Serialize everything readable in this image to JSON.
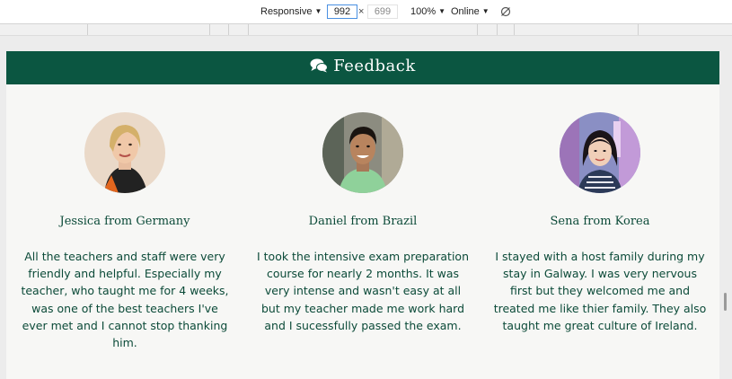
{
  "toolbar": {
    "device": "Responsive",
    "width": "992",
    "height": "699",
    "zoom": "100%",
    "network": "Online",
    "rotate_icon": "rotate-icon"
  },
  "section": {
    "title": "Feedback",
    "icon": "comments-icon",
    "header_color": "#0b5641"
  },
  "testimonials": [
    {
      "name": "Jessica from Germany",
      "quote": "All the teachers and staff were very friendly and helpful. Especially my teacher, who taught me for 4 weeks, was one of the best teachers I've ever met and I cannot stop thanking him."
    },
    {
      "name": "Daniel from Brazil",
      "quote": "I took the intensive exam preparation course for nearly 2 months. It was very intense and wasn't easy at all but my teacher made me work hard and I sucessfully passed the exam."
    },
    {
      "name": "Sena from Korea",
      "quote": "I stayed with a host family during my stay in Galway. I was very nervous first but they welcomed me and treated me like thier family. They also taught me great culture of Ireland."
    }
  ]
}
